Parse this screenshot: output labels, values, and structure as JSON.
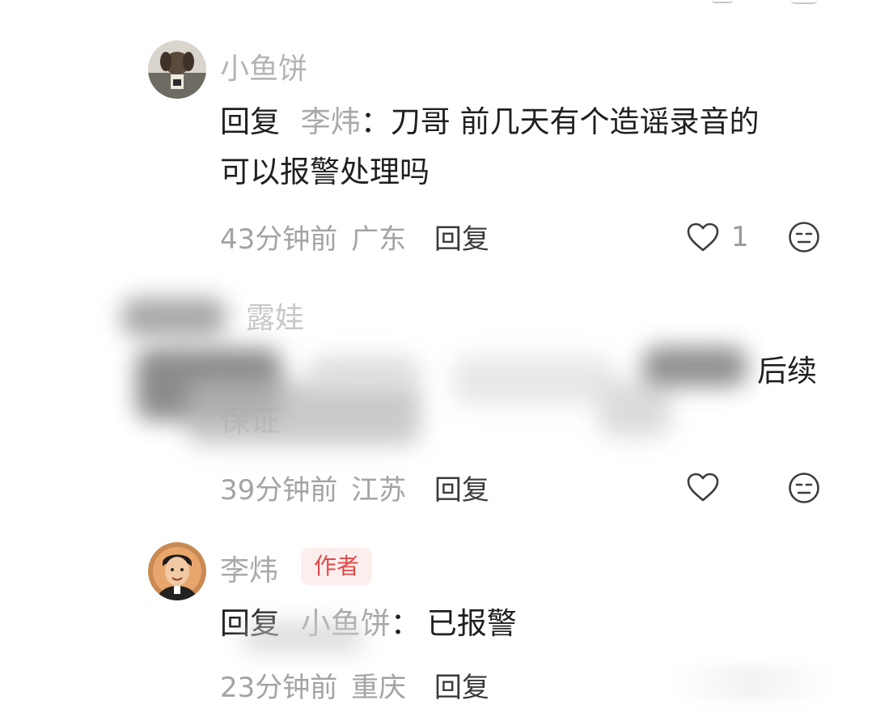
{
  "comments": [
    {
      "name": "小鱼饼",
      "reply_prefix": "回复",
      "mention": "李炜",
      "colon": "：",
      "text_line1": "刀哥 前几天有个造谣录音的",
      "text_line2": "可以报警处理吗",
      "time": "43分钟前",
      "location": "广东",
      "reply_label": "回复",
      "likes": "1"
    },
    {
      "name": "露娃",
      "text_visible_end": "后续",
      "text_line2_fragment": "保证",
      "time": "39分钟前",
      "location": "江苏",
      "reply_label": "回复"
    },
    {
      "name": "李炜",
      "badge": "作者",
      "reply_prefix": "回复",
      "mention": "小鱼饼",
      "colon": "：",
      "text": "已报警",
      "time": "23分钟前",
      "location": "重庆",
      "reply_label": "回复"
    }
  ],
  "colors": {
    "badge_bg": "#fdeeee",
    "badge_text": "#e04a4a",
    "meta_text": "#a3a3a3",
    "name_text": "#b4b4b4"
  },
  "icons": [
    "heart-icon",
    "emoji-face-icon"
  ]
}
